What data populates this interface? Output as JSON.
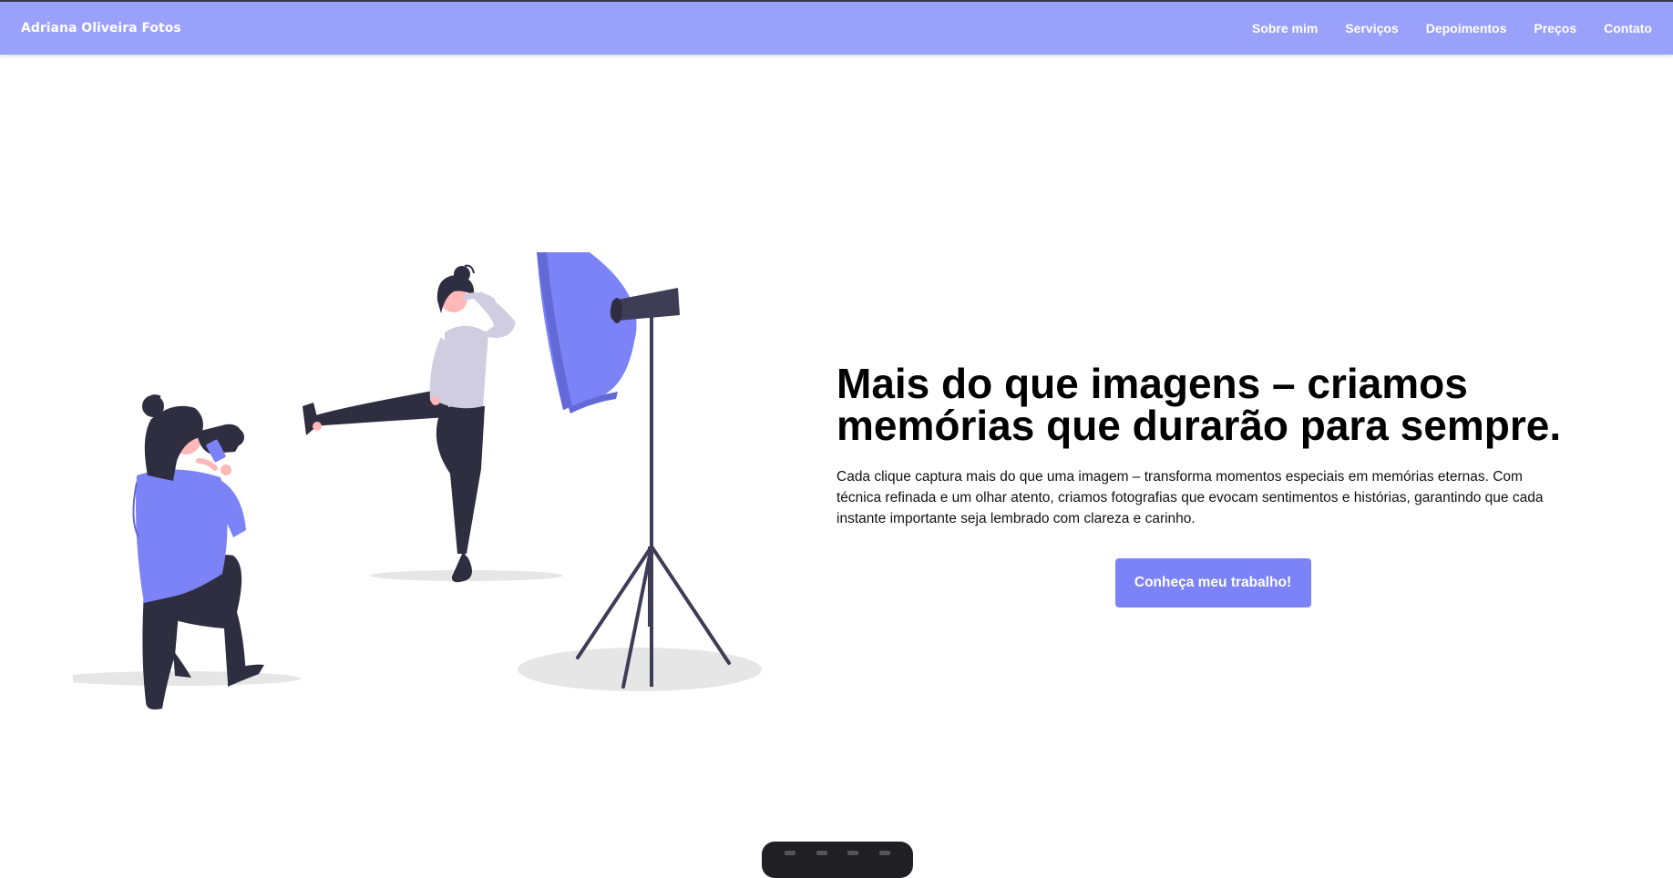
{
  "header": {
    "brand": "Adriana Oliveira Fotos",
    "nav": [
      {
        "label": "Sobre mim"
      },
      {
        "label": "Serviços"
      },
      {
        "label": "Depoimentos"
      },
      {
        "label": "Preços"
      },
      {
        "label": "Contato"
      }
    ]
  },
  "hero": {
    "title": "Mais do que imagens – criamos memórias que durarão para sempre.",
    "description": "Cada clique captura mais do que uma imagem – transforma momentos especiais em memórias eternas. Com técnica refinada e um olhar atento, criamos fotografias que evocam sentimentos e histórias, garantindo que cada instante importante seja lembrado com clareza e carinho.",
    "cta_label": "Conheça meu trabalho!",
    "illustration_icon": "photographer-studio-illustration"
  },
  "colors": {
    "accent": "#9aa1fb",
    "button": "#7c83f7",
    "figure_primary": "#7c83f7",
    "figure_dark": "#2f2e41",
    "figure_light": "#d0cde1",
    "skin": "#ffb8b8",
    "shadow": "#e6e6e6"
  }
}
